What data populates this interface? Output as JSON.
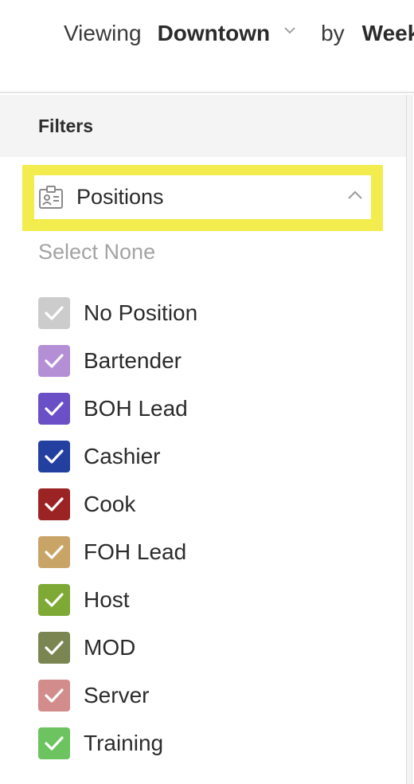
{
  "header": {
    "viewing_label": "Viewing",
    "location": "Downtown",
    "by_label": "by",
    "period": "Week"
  },
  "filters": {
    "title": "Filters",
    "positions_section": {
      "title": "Positions",
      "expanded": true,
      "select_none": "Select None",
      "items": [
        {
          "label": "No Position",
          "color": "#cccccc",
          "checked": true
        },
        {
          "label": "Bartender",
          "color": "#b48fd6",
          "checked": true
        },
        {
          "label": "BOH Lead",
          "color": "#6a4fc7",
          "checked": true
        },
        {
          "label": "Cashier",
          "color": "#233fa0",
          "checked": true
        },
        {
          "label": "Cook",
          "color": "#9b2323",
          "checked": true
        },
        {
          "label": "FOH Lead",
          "color": "#c9a467",
          "checked": true
        },
        {
          "label": "Host",
          "color": "#7ea934",
          "checked": true
        },
        {
          "label": "MOD",
          "color": "#7a8552",
          "checked": true
        },
        {
          "label": "Server",
          "color": "#d38c8c",
          "checked": true
        },
        {
          "label": "Training",
          "color": "#6cc35f",
          "checked": true
        }
      ]
    }
  },
  "colors": {
    "highlight": "#f3ec4e"
  }
}
